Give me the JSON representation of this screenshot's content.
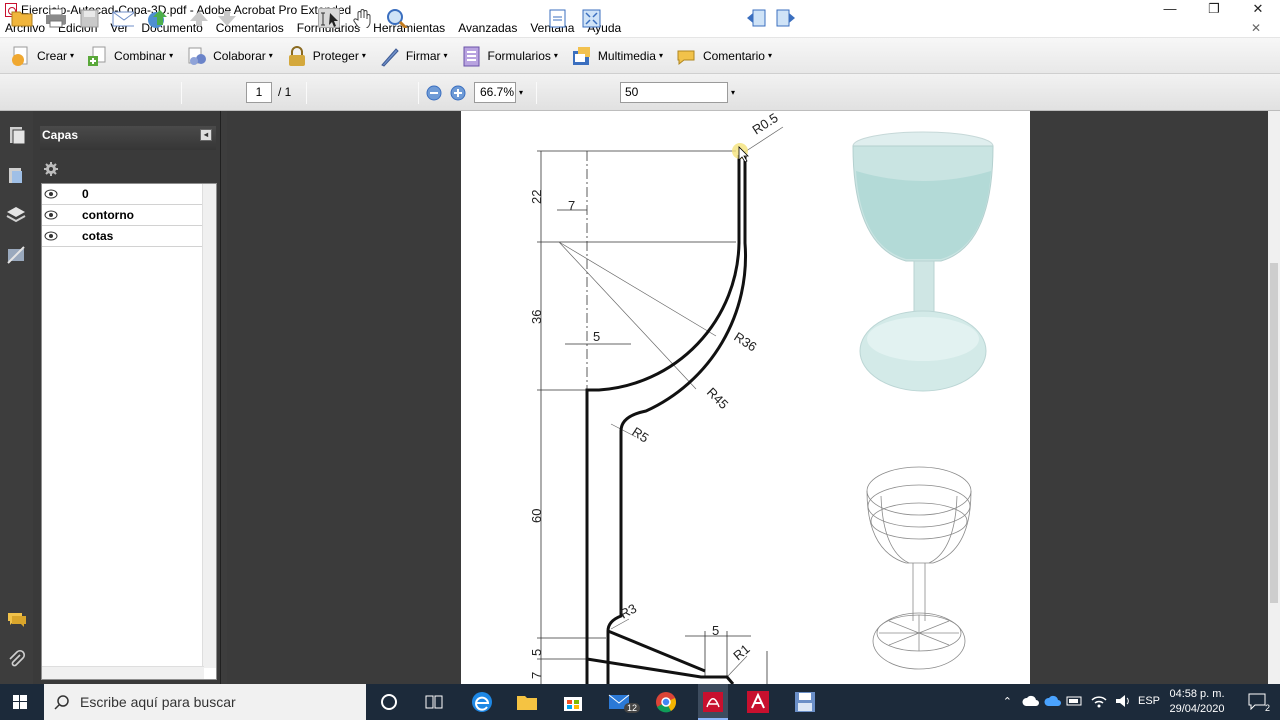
{
  "window": {
    "title": "Ejercicio-Autocad-Copa-3D.pdf - Adobe Acrobat Pro Extended",
    "controls": [
      "—",
      "❐",
      "✕"
    ]
  },
  "menu": [
    "Archivo",
    "Edición",
    "Ver",
    "Documento",
    "Comentarios",
    "Formularios",
    "Herramientas",
    "Avanzadas",
    "Ventana",
    "Ayuda"
  ],
  "tasks": [
    {
      "label": "Crear",
      "icon": "create-icon",
      "color": "#e9a23b"
    },
    {
      "label": "Combinar",
      "icon": "combine-icon",
      "color": "#5aa83a"
    },
    {
      "label": "Colaborar",
      "icon": "collaborate-icon",
      "color": "#6b84c9"
    },
    {
      "label": "Proteger",
      "icon": "lock-icon",
      "color": "#caa03a"
    },
    {
      "label": "Firmar",
      "icon": "pen-icon",
      "color": "#6f8fc8"
    },
    {
      "label": "Formularios",
      "icon": "form-icon",
      "color": "#8a6bbf"
    },
    {
      "label": "Multimedia",
      "icon": "multimedia-icon",
      "color": "#3b6fbf"
    },
    {
      "label": "Comentario",
      "icon": "comment-icon",
      "color": "#f1c24a"
    }
  ],
  "toolbar": {
    "page_current": "1",
    "page_total": "/ 1",
    "zoom": "66.7%",
    "width_value": "50"
  },
  "layers_panel": {
    "title": "Capas",
    "collapse": "◂",
    "layers": [
      "0",
      "contorno",
      "cotas"
    ]
  },
  "drawing": {
    "dimensions": [
      "22",
      "7",
      "36",
      "5",
      "60",
      "5",
      "7",
      "5"
    ],
    "radii": [
      "R0.5",
      "R36",
      "R45",
      "R5",
      "R3",
      "R1"
    ]
  },
  "taskbar": {
    "search_placeholder": "Escribe aquí para buscar",
    "mail_badge": "12",
    "language": "ESP",
    "time": "04:58 p. m.",
    "date": "29/04/2020",
    "notification_count": "2"
  },
  "colors": {
    "accent_red": "#c8102e",
    "dark_panel": "#3a3a3a",
    "taskbar": "#1c2a3a"
  }
}
